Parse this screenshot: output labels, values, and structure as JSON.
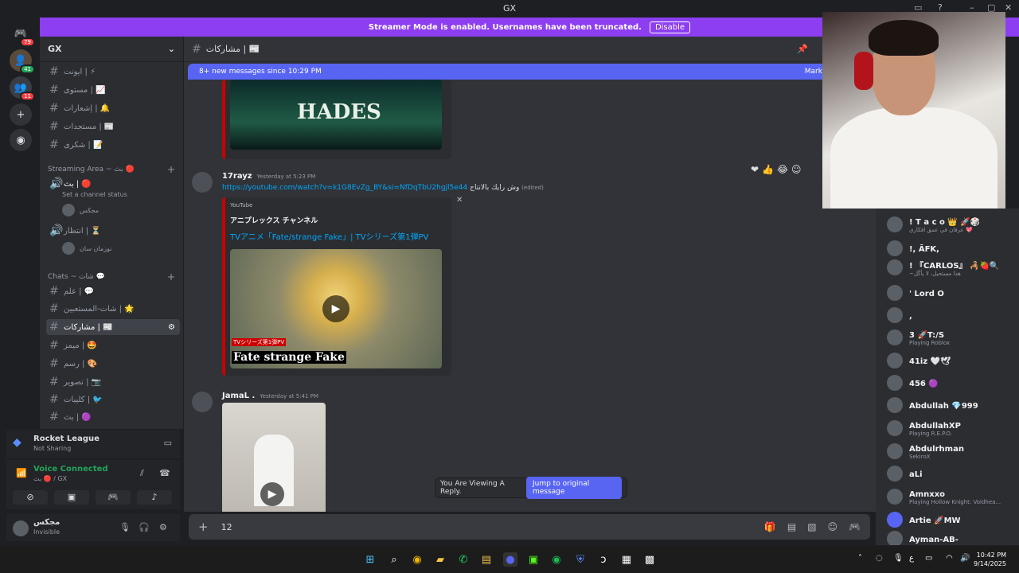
{
  "window": {
    "title": "GX"
  },
  "banner": {
    "text": "Streamer Mode is enabled. Usernames have been truncated.",
    "button": "Disable"
  },
  "servers": {
    "badge_top": "79",
    "badge_2": "41",
    "badge_3": "11"
  },
  "guild": {
    "name": "GX"
  },
  "channels": {
    "top": [
      {
        "name": "ايونت | ⚡"
      },
      {
        "name": "مستوى | 📈"
      },
      {
        "name": "إشعارات | 🔔"
      },
      {
        "name": "مستجدات | 📰"
      },
      {
        "name": "شكرى | 📝"
      }
    ],
    "streaming_cat": "Streaming Area ~ بث 🔴",
    "voice1": "بث | 🔴",
    "voice1_status": "Set a channel status",
    "voice1_user": "مجكس",
    "voice2": "انتظار | ⏳",
    "voice2_user": "نوزمان سان",
    "chats_cat": "Chats ~ شات 💬",
    "chats": [
      {
        "name": "علم | 💬"
      },
      {
        "name": "شات-المستعبين | 🌟"
      },
      {
        "name": "مشاركات | 📰"
      },
      {
        "name": "ميمز | 🤩"
      },
      {
        "name": "رسم | 🎨"
      },
      {
        "name": "تصوير | 📷"
      },
      {
        "name": "كليبات | 🐦"
      },
      {
        "name": "بث | 🟣"
      }
    ]
  },
  "activity": {
    "game": "Rocket League",
    "status": "Not Sharing"
  },
  "voice": {
    "title": "Voice Connected",
    "sub": "بث 🔴 / GX"
  },
  "user": {
    "name": "مجكس",
    "status": "Invisible"
  },
  "chat": {
    "channel": "مشاركات | 📰",
    "new_messages": "8+ new messages since 10:29 PM",
    "mark": "Mark A",
    "hades": "HADES",
    "msg1": {
      "author": "17rayz",
      "time": "Yesterday at 5:23 PM",
      "link": "https://youtube.com/watch?v=k1G8EvZg_BY&si=NfDqTbU2hgjl5e44",
      "text": "وش رايك بالانتاج",
      "edited": "(edited)"
    },
    "embed1": {
      "provider": "YouTube",
      "channel": "アニプレックス チャンネル",
      "title": "TVアニメ「Fate/strange Fake」| TVシリーズ第1弾PV",
      "overlay_small": "TVシリーズ第1弾PV",
      "overlay_big": "Fate strange Fake"
    },
    "msg2": {
      "author": "JamaL .",
      "time": "Yesterday at 5:41 PM"
    },
    "reply": {
      "text": "You Are Viewing A Reply.",
      "button": "Jump to original message"
    },
    "composer": {
      "value": "12"
    }
  },
  "members": [
    {
      "name": "! T a c o 👑 🚀🎲",
      "status": "عرفان في عمق افكاري 💖"
    },
    {
      "name": "!, ĀFK,",
      "status": ""
    },
    {
      "name": "! 『CARLOS』 🦂🍓🔍",
      "status": "~هذا مستحيل، لا يأكّل"
    },
    {
      "name": "' Lord O",
      "status": ""
    },
    {
      "name": ",",
      "status": ""
    },
    {
      "name": "3 🚀T:/S",
      "status": "Playing Roblox"
    },
    {
      "name": "41iz 🤍🕊",
      "status": ""
    },
    {
      "name": "456 🟣",
      "status": ""
    },
    {
      "name": "Abdullah 💎999",
      "status": ""
    },
    {
      "name": "AbdullahXP",
      "status": "Playing R.E.P.O."
    },
    {
      "name": "Abdulrhman",
      "status": "SekiroX"
    },
    {
      "name": "aLi",
      "status": ""
    },
    {
      "name": "Amnxxo",
      "status": "Playing Hollow Knight: Voidhea..."
    },
    {
      "name": "Artie 🚀MW",
      "status": ""
    },
    {
      "name": "Ayman-AB-",
      "status": ""
    }
  ],
  "taskbar": {
    "time": "10:42 PM",
    "date": "9/14/2025",
    "lang": "ع"
  },
  "colors": {
    "accent": "#5865f2",
    "streamer": "#8c3ef0",
    "embed_bar": "#cc0000"
  }
}
